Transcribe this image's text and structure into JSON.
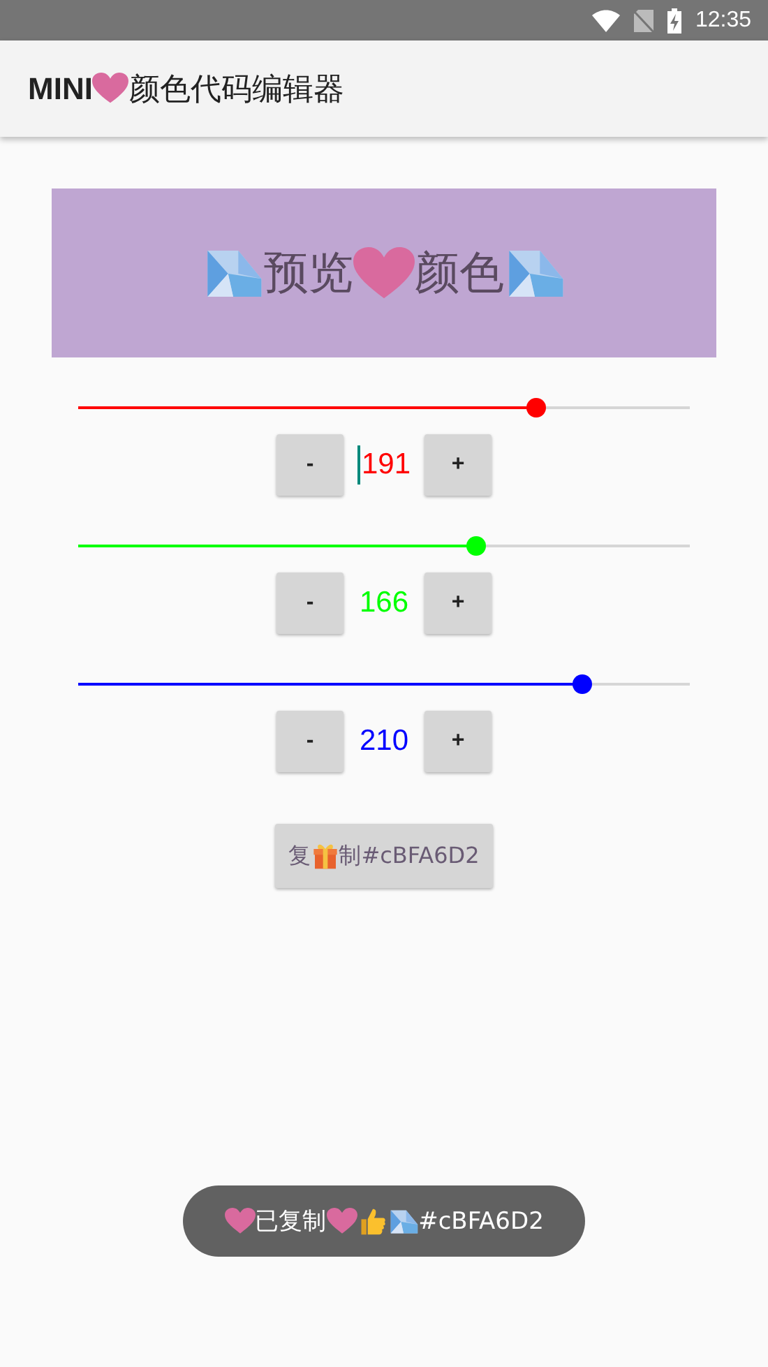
{
  "status_bar": {
    "time": "12:35"
  },
  "app_bar": {
    "title": [
      {
        "kind": "text",
        "text": "MINI"
      },
      {
        "kind": "heart"
      },
      {
        "kind": "text",
        "text": "颜色代码编辑器"
      }
    ]
  },
  "preview": {
    "content": [
      {
        "kind": "diamond"
      },
      {
        "kind": "text",
        "text": "预览"
      },
      {
        "kind": "heart"
      },
      {
        "kind": "text",
        "text": "颜色"
      },
      {
        "kind": "diamond"
      }
    ]
  },
  "channels": [
    {
      "color": "#ff0000",
      "level": 0.749,
      "value": "191",
      "focused": true,
      "minus": "-",
      "plus": "+"
    },
    {
      "color": "#00ff00",
      "level": 0.651,
      "value": "166",
      "focused": false,
      "minus": "-",
      "plus": "+"
    },
    {
      "color": "#0000ff",
      "level": 0.824,
      "value": "210",
      "focused": false,
      "minus": "-",
      "plus": "+"
    }
  ],
  "copy_button": {
    "content": [
      {
        "kind": "text",
        "text": "复"
      },
      {
        "kind": "gift"
      },
      {
        "kind": "text",
        "text": "制#cBFA6D2"
      }
    ]
  },
  "toast": {
    "content": [
      {
        "kind": "heart"
      },
      {
        "kind": "text",
        "text": "已复制"
      },
      {
        "kind": "heart"
      },
      {
        "kind": "thumbs-up"
      },
      {
        "kind": "diamond"
      },
      {
        "kind": "text",
        "text": "#cBFA6D2"
      }
    ]
  }
}
